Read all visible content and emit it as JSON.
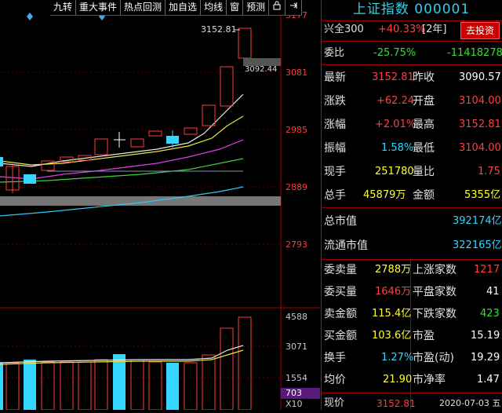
{
  "toolbar": {
    "items": [
      "九转",
      "重大事件",
      "热点回测",
      "加自选",
      "均线",
      "窗",
      "预测"
    ]
  },
  "chart": {
    "price_axis": [
      "3177",
      "3081",
      "2985",
      "2889",
      "2793"
    ],
    "volume_axis": [
      "4588",
      "3071",
      "1554"
    ],
    "high_marker": "3152.81",
    "price_tag": "3092.44",
    "vol_value": "703",
    "vol_unit": "X10"
  },
  "panel": {
    "title": "上证指数 000001",
    "sector": {
      "label": "兴全300",
      "value": "+40.33%",
      "period": "[2年]",
      "button": "去投资"
    },
    "weibi": {
      "label": "委比",
      "value": "-25.75%",
      "diff": "-11418278"
    },
    "quote": [
      {
        "l": "最新",
        "v": "3152.81",
        "l2": "昨收",
        "v2": "3090.57"
      },
      {
        "l": "涨跌",
        "v": "+62.24",
        "l2": "开盘",
        "v2": "3104.00"
      },
      {
        "l": "涨幅",
        "v": "+2.01%",
        "l2": "最高",
        "v2": "3152.81"
      },
      {
        "l": "振幅",
        "v": "1.58%",
        "l2": "最低",
        "v2": "3104.00"
      },
      {
        "l": "现手",
        "v": "251780",
        "l2": "量比",
        "v2": "1.75"
      },
      {
        "l": "总手",
        "v": "45879万",
        "l2": "金额",
        "v2": "5355亿"
      }
    ],
    "market_value": {
      "label": "总市值",
      "value": "392174亿"
    },
    "float_value": {
      "label": "流通市值",
      "value": "322165亿"
    },
    "stats": [
      {
        "l": "委卖量",
        "v": "2788万",
        "l2": "上涨家数",
        "v2": "1217"
      },
      {
        "l": "委买量",
        "v": "1646万",
        "l2": "平盘家数",
        "v2": "41"
      },
      {
        "l": "卖金额",
        "v": "115.4亿",
        "l2": "下跌家数",
        "v2": "423"
      },
      {
        "l": "买金额",
        "v": "103.6亿",
        "l2": "市盈",
        "v2": "15.19"
      },
      {
        "l": "换手",
        "v": "1.27%",
        "l2": "市盈(动)",
        "v2": "19.29"
      },
      {
        "l": "均价",
        "v": "21.90",
        "l2": "市净率",
        "v2": "1.47"
      }
    ],
    "bottom": {
      "label": "现价",
      "value": "3152.81",
      "date": "2020-07-03 五"
    }
  }
}
